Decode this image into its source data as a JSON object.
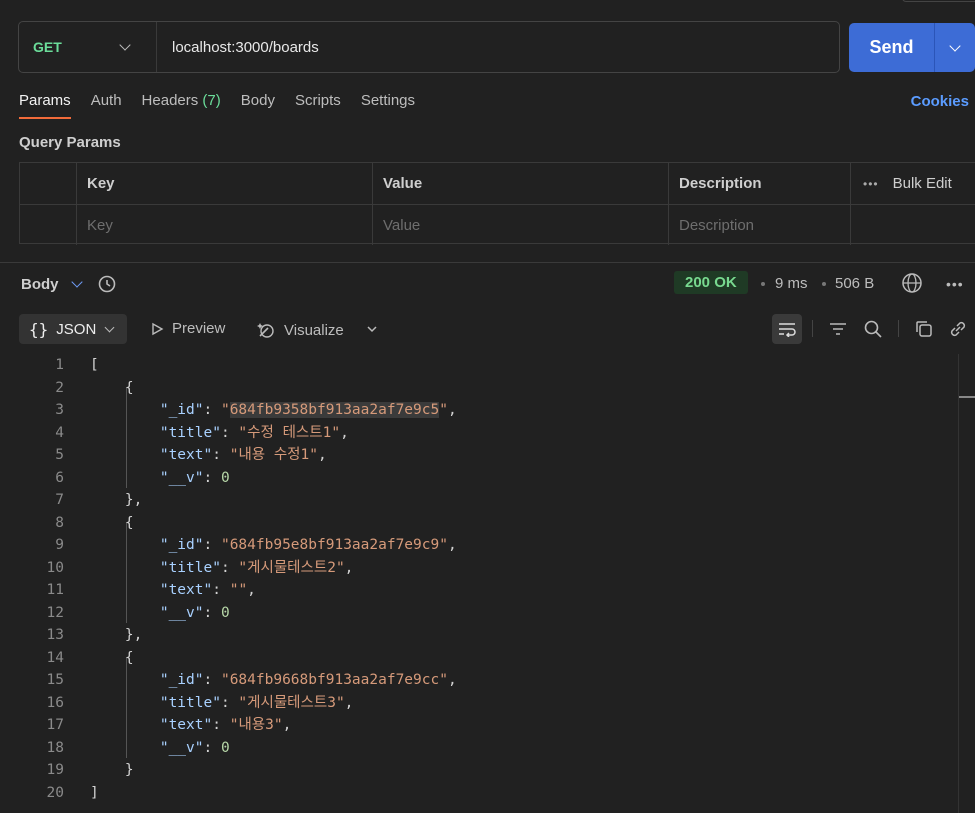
{
  "request": {
    "method": "GET",
    "url": "localhost:3000/boards",
    "send_label": "Send"
  },
  "tabs": [
    {
      "label": "Params",
      "active": true
    },
    {
      "label": "Auth"
    },
    {
      "label": "Headers",
      "count": "(7)"
    },
    {
      "label": "Body"
    },
    {
      "label": "Scripts"
    },
    {
      "label": "Settings"
    }
  ],
  "cookies_label": "Cookies",
  "query_params": {
    "title": "Query Params",
    "headers": {
      "key": "Key",
      "value": "Value",
      "description": "Description",
      "bulk_edit": "Bulk Edit"
    },
    "placeholders": {
      "key": "Key",
      "value": "Value",
      "description": "Description"
    }
  },
  "response": {
    "body_label": "Body",
    "status": "200 OK",
    "time": "9 ms",
    "size": "506 B",
    "format": "JSON",
    "preview_label": "Preview",
    "visualize_label": "Visualize"
  },
  "code_lines": [
    {
      "n": "1"
    },
    {
      "n": "2"
    },
    {
      "n": "3"
    },
    {
      "n": "4"
    },
    {
      "n": "5"
    },
    {
      "n": "6"
    },
    {
      "n": "7"
    },
    {
      "n": "8"
    },
    {
      "n": "9"
    },
    {
      "n": "10"
    },
    {
      "n": "11"
    },
    {
      "n": "12"
    },
    {
      "n": "13"
    },
    {
      "n": "14"
    },
    {
      "n": "15"
    },
    {
      "n": "16"
    },
    {
      "n": "17"
    },
    {
      "n": "18"
    },
    {
      "n": "19"
    },
    {
      "n": "20"
    }
  ],
  "json_body": [
    {
      "_id": "684fb9358bf913aa2af7e9c5",
      "title": "수정 테스트1",
      "text": "내용 수정1",
      "__v": "0"
    },
    {
      "_id": "684fb95e8bf913aa2af7e9c9",
      "title": "게시물테스트2",
      "text": "",
      "__v": "0"
    },
    {
      "_id": "684fb9668bf913aa2af7e9cc",
      "title": "게시물테스트3",
      "text": "내용3",
      "__v": "0"
    }
  ],
  "colors": {
    "accent_blue": "#3d6cd6",
    "method_green": "#6bdd9a",
    "active_tab_underline": "#f26b3a",
    "status_green": "#78d98f",
    "cookies_link": "#5b9cff"
  },
  "icons": [
    "chevron-down-icon",
    "history-icon",
    "globe-icon",
    "more-icon",
    "braces-icon",
    "play-icon",
    "visualize-icon",
    "wrap-icon",
    "filter-icon",
    "search-icon",
    "copy-icon",
    "link-icon"
  ]
}
